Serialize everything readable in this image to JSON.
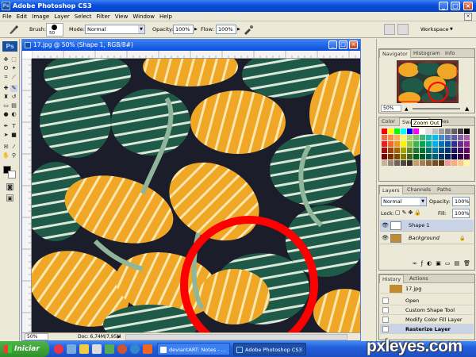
{
  "window": {
    "title": "Adobe Photoshop CS3",
    "app_icon": "Ps"
  },
  "menu": [
    "File",
    "Edit",
    "Image",
    "Layer",
    "Select",
    "Filter",
    "View",
    "Window",
    "Help"
  ],
  "options": {
    "brush_label": "Brush:",
    "brush_size": "50",
    "mode_label": "Mode:",
    "mode_value": "Normal",
    "opacity_label": "Opacity:",
    "opacity_value": "100%",
    "flow_label": "Flow:",
    "flow_value": "100%",
    "workspace_label": "Workspace"
  },
  "toolbox": {
    "logo": "Ps"
  },
  "document": {
    "title": "17.jpg @ 50% (Shape 1, RGB/8#)",
    "status_zoom": "50%",
    "status_doc": "Doc: 6,74M/7,95M"
  },
  "navigator": {
    "tabs": [
      "Navigator",
      "Histogram",
      "Info"
    ],
    "zoom": "50%"
  },
  "swatches": {
    "tabs": [
      "Color",
      "Swatches",
      "Styles"
    ],
    "tooltip": "Zoom Out",
    "colors": [
      "#ff0000",
      "#ffff00",
      "#00ff00",
      "#00ffff",
      "#0000ff",
      "#ff00ff",
      "#ffffff",
      "#e0e0e0",
      "#c0c0c0",
      "#a0a0a0",
      "#808080",
      "#606060",
      "#404040",
      "#000000",
      "#f26c4f",
      "#f68e55",
      "#fbaf5c",
      "#fff467",
      "#acd372",
      "#7cc576",
      "#3bb878",
      "#1abbb4",
      "#00bff3",
      "#438ccb",
      "#5574b9",
      "#605ca8",
      "#855fa8",
      "#a763a8",
      "#ed1c24",
      "#f26522",
      "#f7941d",
      "#fff200",
      "#8dc63f",
      "#39b54a",
      "#00a651",
      "#00a99d",
      "#00aeef",
      "#0072bc",
      "#0054a6",
      "#2e3192",
      "#662d91",
      "#92278f",
      "#9e0b0f",
      "#a0410d",
      "#a36209",
      "#aba000",
      "#598527",
      "#1a7b30",
      "#007236",
      "#00746b",
      "#0076a3",
      "#004b80",
      "#003471",
      "#1b1464",
      "#440e62",
      "#630460",
      "#790000",
      "#7b2e00",
      "#7d4900",
      "#827b00",
      "#406618",
      "#005e20",
      "#005826",
      "#005952",
      "#005b7f",
      "#003663",
      "#002157",
      "#0d004c",
      "#32004b",
      "#4b0049",
      "#c7b299",
      "#998675",
      "#736357",
      "#534741",
      "#37302a",
      "#c69c6d",
      "#a67c52",
      "#8c6239",
      "#754c24",
      "#603913",
      "#f5989d",
      "#f9ad81",
      "#fdc68a",
      "#fff79a"
    ]
  },
  "layers": {
    "tabs": [
      "Layers",
      "Channels",
      "Paths"
    ],
    "blend_mode": "Normal",
    "opacity_label": "Opacity:",
    "opacity_value": "100%",
    "lock_label": "Lock:",
    "fill_label": "Fill:",
    "fill_value": "100%",
    "items": [
      {
        "name": "Shape 1",
        "selected": true
      },
      {
        "name": "Background",
        "selected": false
      }
    ]
  },
  "history": {
    "tabs": [
      "History",
      "Actions"
    ],
    "snapshot": "17.jpg",
    "items": [
      "Open",
      "Custom Shape Tool",
      "Modify Color Fill Layer",
      "Rasterize Layer"
    ]
  },
  "taskbar": {
    "start_label": "Iniciar",
    "buttons": [
      "deviantART: Notes - ...",
      "Adobe Photoshop CS3"
    ]
  },
  "watermark": "pxleyes.com",
  "colors": {
    "accent_blue": "#0a4ddb",
    "circle_red": "#ff0000",
    "gourd_green": "#1f5a48",
    "gourd_orange": "#f0a726"
  }
}
